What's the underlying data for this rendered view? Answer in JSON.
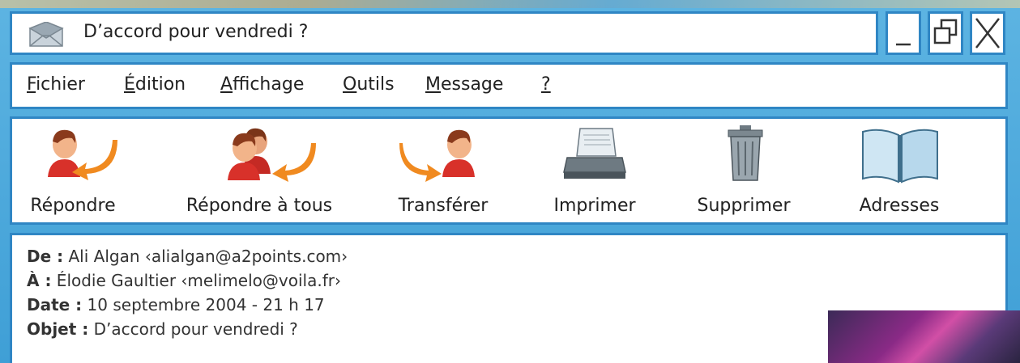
{
  "window": {
    "title": "D’accord pour vendredi ?",
    "buttons": {
      "minimize": "minimize-icon",
      "maximize": "restore-icon",
      "close": "close-icon"
    }
  },
  "menu": {
    "items": [
      {
        "first": "F",
        "rest": "ichier"
      },
      {
        "first": "É",
        "rest": "dition"
      },
      {
        "first": "A",
        "rest": "ffichage"
      },
      {
        "first": "O",
        "rest": "utils"
      },
      {
        "first": "M",
        "rest": "essage"
      },
      {
        "first": "?",
        "rest": ""
      }
    ]
  },
  "toolbar": {
    "items": [
      {
        "label": "Répondre",
        "icon": "reply-icon"
      },
      {
        "label": "Répondre à tous",
        "icon": "reply-all-icon"
      },
      {
        "label": "Transférer",
        "icon": "forward-icon"
      },
      {
        "label": "Imprimer",
        "icon": "printer-icon"
      },
      {
        "label": "Supprimer",
        "icon": "trash-icon"
      },
      {
        "label": "Adresses",
        "icon": "address-book-icon"
      }
    ]
  },
  "message": {
    "from_label": "De :",
    "from_value": " Ali Algan ‹alialgan@a2points.com›",
    "to_label": "À :",
    "to_value": " Élodie Gaultier ‹melimelo@voila.fr›",
    "date_label": "Date :",
    "date_value": " 10 septembre 2004 - 21 h 17",
    "subject_label": "Objet :",
    "subject_value": " D’accord pour vendredi ?"
  },
  "colors": {
    "frame": "#4aa7d8",
    "border": "#2f86c4",
    "panel": "#ffffff"
  }
}
